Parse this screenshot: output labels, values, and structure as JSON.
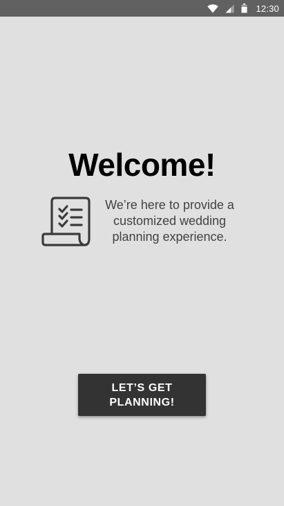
{
  "status_bar": {
    "time": "12:30",
    "icons": [
      "wifi-icon",
      "cell-signal-icon",
      "battery-icon"
    ],
    "background": "#616161"
  },
  "welcome": {
    "title": "Welcome!",
    "icon": "checklist-scroll-icon",
    "message": "We’re here to provide a customized wedding planning experience."
  },
  "cta": {
    "label_line1": "LET’S GET",
    "label_line2": "PLANNING!",
    "background": "#333333"
  },
  "colors": {
    "page_background": "#e0e0e0",
    "title": "#000000",
    "body_text": "#424242"
  }
}
